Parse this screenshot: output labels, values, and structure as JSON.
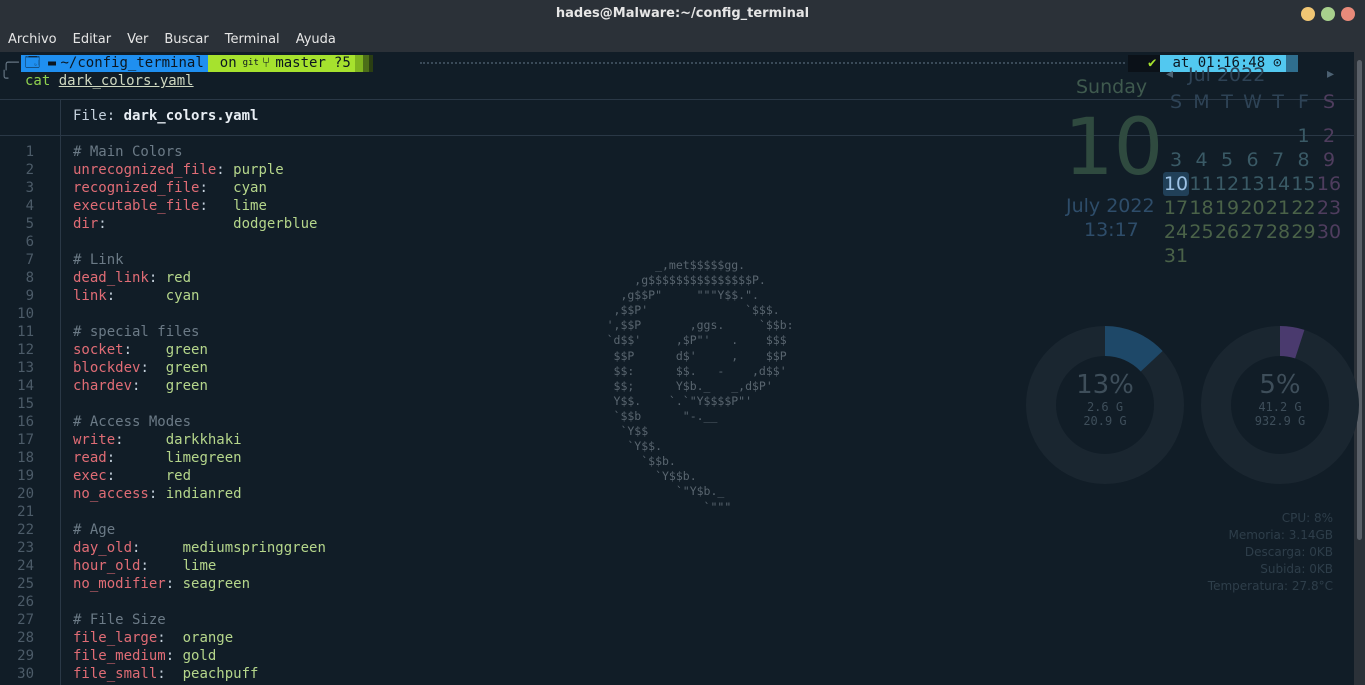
{
  "window": {
    "title": "hades@Malware:~/config_terminal"
  },
  "menu": {
    "items": [
      "Archivo",
      "Editar",
      "Ver",
      "Buscar",
      "Terminal",
      "Ayuda"
    ]
  },
  "prompt": {
    "os_icon": "🗔",
    "path": "~/config_terminal",
    "git_prefix": "on",
    "git_label": "git",
    "branch_icon": "branch-icon",
    "branch": "master",
    "status": "?5",
    "check": "✔",
    "time_label": "at 01:16:48",
    "clock_icon": "⊙",
    "folder_icon": "▬"
  },
  "command": {
    "cmd": "cat",
    "arg": "dark_colors.yaml"
  },
  "file_header": {
    "label": "File:",
    "name": "dark_colors.yaml"
  },
  "lines": [
    [
      [
        "c",
        "# Main Colors"
      ]
    ],
    [
      [
        "k",
        "unrecognized_file"
      ],
      [
        "p",
        ": "
      ],
      [
        "v",
        "purple"
      ]
    ],
    [
      [
        "k",
        "recognized_file"
      ],
      [
        "p",
        ":   "
      ],
      [
        "v",
        "cyan"
      ]
    ],
    [
      [
        "k",
        "executable_file"
      ],
      [
        "p",
        ":   "
      ],
      [
        "v",
        "lime"
      ]
    ],
    [
      [
        "k",
        "dir"
      ],
      [
        "p",
        ":               "
      ],
      [
        "v",
        "dodgerblue"
      ]
    ],
    [],
    [
      [
        "c",
        "# Link"
      ]
    ],
    [
      [
        "k",
        "dead_link"
      ],
      [
        "p",
        ": "
      ],
      [
        "v",
        "red"
      ]
    ],
    [
      [
        "k",
        "link"
      ],
      [
        "p",
        ":      "
      ],
      [
        "v",
        "cyan"
      ]
    ],
    [],
    [
      [
        "c",
        "# special files"
      ]
    ],
    [
      [
        "k",
        "socket"
      ],
      [
        "p",
        ":    "
      ],
      [
        "v",
        "green"
      ]
    ],
    [
      [
        "k",
        "blockdev"
      ],
      [
        "p",
        ":  "
      ],
      [
        "v",
        "green"
      ]
    ],
    [
      [
        "k",
        "chardev"
      ],
      [
        "p",
        ":   "
      ],
      [
        "v",
        "green"
      ]
    ],
    [],
    [
      [
        "c",
        "# Access Modes"
      ]
    ],
    [
      [
        "k",
        "write"
      ],
      [
        "p",
        ":     "
      ],
      [
        "v",
        "darkkhaki"
      ]
    ],
    [
      [
        "k",
        "read"
      ],
      [
        "p",
        ":      "
      ],
      [
        "v",
        "limegreen"
      ]
    ],
    [
      [
        "k",
        "exec"
      ],
      [
        "p",
        ":      "
      ],
      [
        "v",
        "red"
      ]
    ],
    [
      [
        "k",
        "no_access"
      ],
      [
        "p",
        ": "
      ],
      [
        "v",
        "indianred"
      ]
    ],
    [],
    [
      [
        "c",
        "# Age"
      ]
    ],
    [
      [
        "k",
        "day_old"
      ],
      [
        "p",
        ":     "
      ],
      [
        "v",
        "mediumspringgreen"
      ]
    ],
    [
      [
        "k",
        "hour_old"
      ],
      [
        "p",
        ":    "
      ],
      [
        "v",
        "lime"
      ]
    ],
    [
      [
        "k",
        "no_modifier"
      ],
      [
        "p",
        ": "
      ],
      [
        "v",
        "seagreen"
      ]
    ],
    [],
    [
      [
        "c",
        "# File Size"
      ]
    ],
    [
      [
        "k",
        "file_large"
      ],
      [
        "p",
        ":  "
      ],
      [
        "v",
        "orange"
      ]
    ],
    [
      [
        "k",
        "file_medium"
      ],
      [
        "p",
        ": "
      ],
      [
        "v",
        "gold"
      ]
    ],
    [
      [
        "k",
        "file_small"
      ],
      [
        "p",
        ":  "
      ],
      [
        "v",
        "peachpuff"
      ]
    ]
  ],
  "ascii_art": [
    "            _,met$$$$$gg.",
    "         ,g$$$$$$$$$$$$$$$P.",
    "       ,g$$P\"     \"\"\"Y$$.\".",
    "      ,$$P'              `$$$.",
    "     ',$$P       ,ggs.     `$$b:",
    "     `d$$'     ,$P\"'   .    $$$",
    "      $$P      d$'     ,    $$P",
    "      $$:      $$.   -    ,d$$'",
    "      $$;      Y$b._   _,d$P'",
    "      Y$$.    `.`\"Y$$$$P\"'",
    "      `$$b      \"-.__",
    "       `Y$$",
    "        `Y$$.",
    "          `$$b.",
    "            `Y$$b.",
    "               `\"Y$b._",
    "                   `\"\"\""
  ],
  "conky": {
    "weekday": "Sunday",
    "day": "10",
    "month_year": "July 2022",
    "time": "13:17",
    "calendar_title": "Jul 2022",
    "weekday_headers": [
      "S",
      "M",
      "T",
      "W",
      "T",
      "F",
      "S"
    ],
    "weeks": [
      [
        "",
        "",
        "",
        "",
        "",
        "1",
        "2"
      ],
      [
        "3",
        "4",
        "5",
        "6",
        "7",
        "8",
        "9"
      ],
      [
        "10",
        "11",
        "12",
        "13",
        "14",
        "15",
        "16"
      ],
      [
        "17",
        "18",
        "19",
        "20",
        "21",
        "22",
        "23"
      ],
      [
        "24",
        "25",
        "26",
        "27",
        "28",
        "29",
        "30"
      ],
      [
        "31",
        "",
        "",
        "",
        "",
        "",
        ""
      ]
    ],
    "today": "10",
    "disks": [
      {
        "percent_label": "13%",
        "used": "2.6 G",
        "total": "20.9 G",
        "fraction": 0.13,
        "color": "#1e4868"
      },
      {
        "percent_label": "5%",
        "used": "41.2 G",
        "total": "932.9 G",
        "fraction": 0.05,
        "color": "#4a3a6e"
      }
    ],
    "stats": [
      "CPU: 8%",
      "Memoria: 3.14GB",
      "Descarga: 0KB",
      "Subida: 0KB",
      "Temperatura: 27.8°C"
    ]
  },
  "colors": {
    "titlebar_bg": "#2b3138",
    "terminal_bg": "#111d27",
    "key": "#e06c75",
    "value": "#b5d68b",
    "comment": "#6b7a86",
    "prompt_blue": "#1f8ff0",
    "prompt_lime": "#a6e22e"
  }
}
